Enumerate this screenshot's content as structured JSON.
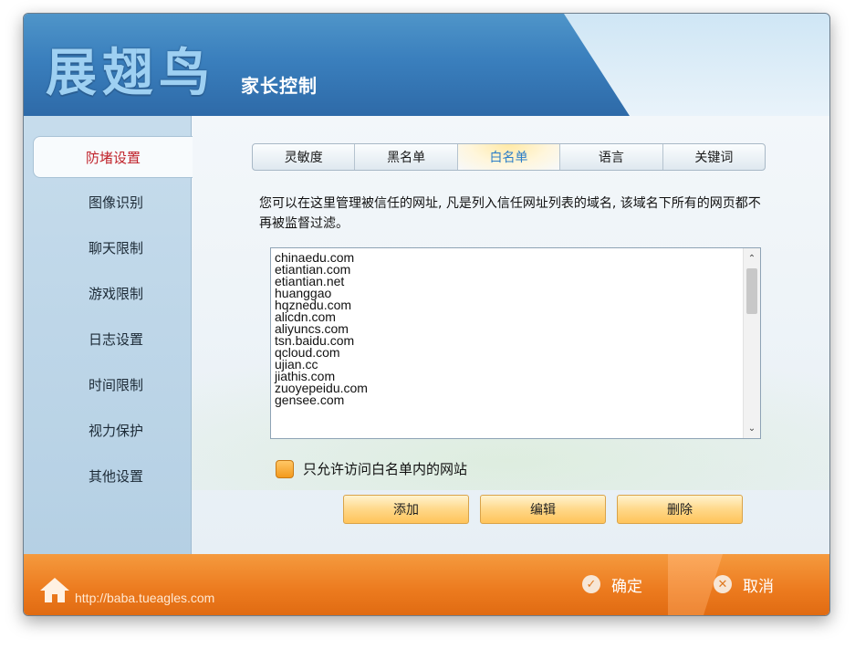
{
  "header": {
    "logo": "展翅鸟",
    "subtitle": "家长控制"
  },
  "sidebar": {
    "items": [
      "防堵设置",
      "图像识别",
      "聊天限制",
      "游戏限制",
      "日志设置",
      "时间限制",
      "视力保护",
      "其他设置"
    ],
    "active": 0
  },
  "tabs": {
    "items": [
      "灵敏度",
      "黑名单",
      "白名单",
      "语言",
      "关键词"
    ],
    "active": 2
  },
  "whitelist": {
    "description": "您可以在这里管理被信任的网址, 凡是列入信任网址列表的域名, 该域名下所有的网页都不再被监督过滤。",
    "sites": [
      "chinaedu.com",
      "etiantian.com",
      "etiantian.net",
      "huanggao",
      "hqznedu.com",
      "alicdn.com",
      "aliyuncs.com",
      "tsn.baidu.com",
      "qcloud.com",
      "ujian.cc",
      "jiathis.com",
      "zuoyepeidu.com",
      "gensee.com"
    ]
  },
  "options": {
    "only_whitelist_label": "只允许访问白名单内的网站",
    "only_whitelist_checked": false
  },
  "buttons": {
    "add": "添加",
    "edit": "编辑",
    "delete": "删除"
  },
  "footer": {
    "url": "http://baba.tueagles.com",
    "confirm": "确定",
    "cancel": "取消"
  },
  "colors": {
    "accent": "#2b7ec8",
    "active_side": "#c0232b",
    "footer": "#ec7a1e"
  }
}
